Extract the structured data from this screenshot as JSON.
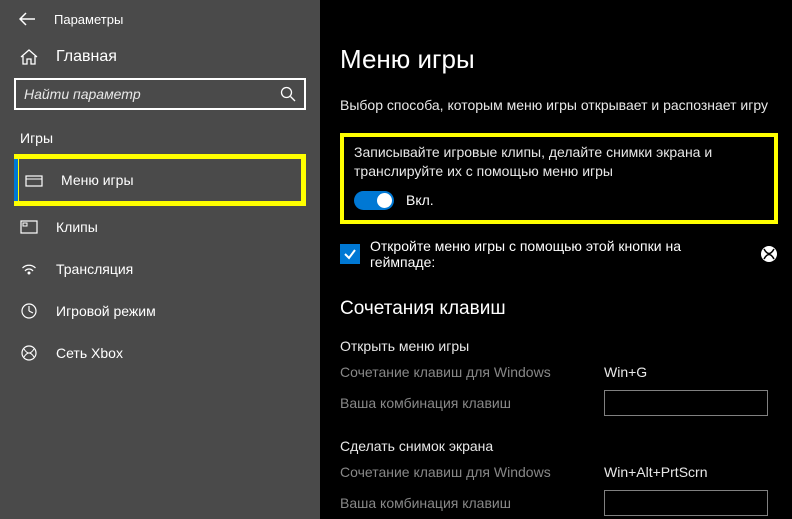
{
  "header": {
    "title": "Параметры"
  },
  "sidebar": {
    "home": "Главная",
    "search_placeholder": "Найти параметр",
    "section": "Игры",
    "items": [
      {
        "label": "Меню игры"
      },
      {
        "label": "Клипы"
      },
      {
        "label": "Трансляция"
      },
      {
        "label": "Игровой режим"
      },
      {
        "label": "Сеть Xbox"
      }
    ]
  },
  "main": {
    "title": "Меню игры",
    "subtitle": "Выбор способа, которым меню игры открывает и распознает игру",
    "highlight_text": "Записывайте игровые клипы, делайте снимки экрана и транслируйте их с помощью меню игры",
    "toggle_label": "Вкл.",
    "checkbox_text": "Откройте меню игры с помощью этой кнопки на геймпаде:",
    "shortcuts_heading": "Сочетания клавиш",
    "shortcut_win_label": "Сочетание клавиш для Windows",
    "shortcut_user_label": "Ваша комбинация клавиш",
    "groups": [
      {
        "title": "Открыть меню игры",
        "win_value": "Win+G"
      },
      {
        "title": "Сделать снимок экрана",
        "win_value": "Win+Alt+PrtScrn"
      }
    ]
  }
}
